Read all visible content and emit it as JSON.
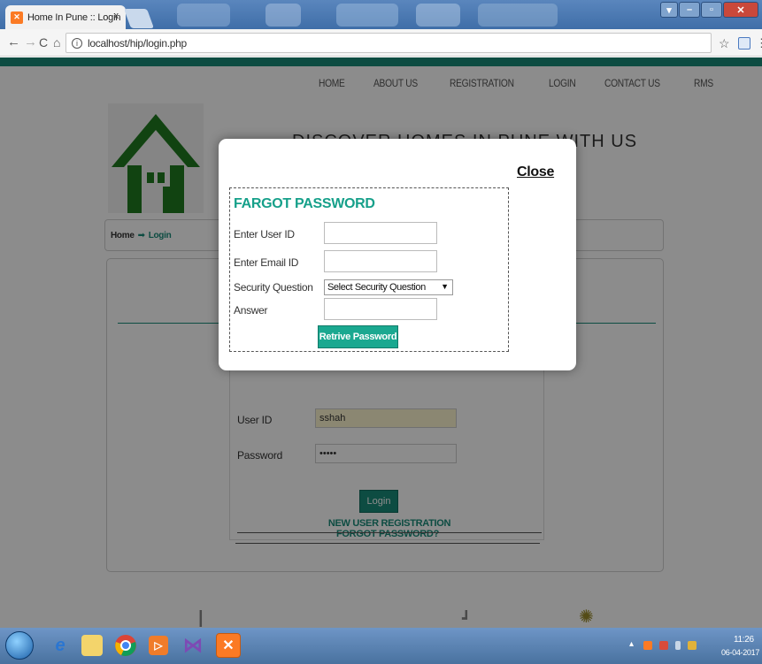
{
  "browser": {
    "tab_title": "Home In Pune :: Login",
    "tab_close": "x",
    "favicon": "xampp-icon",
    "url": "localhost/hip/login.php",
    "back_icon": "back-arrow-icon",
    "forward_icon": "forward-arrow-icon",
    "reload_icon": "reload-icon",
    "home_icon": "home-icon",
    "bookmark_icon": "star-icon"
  },
  "page": {
    "nav": [
      "HOME",
      "ABOUT US",
      "REGISTRATION",
      "LOGIN",
      "CONTACT US",
      "RMS"
    ],
    "tagline": "DISCOVER HOMES IN PUNE WITH US",
    "breadcrumb": {
      "home": "Home",
      "current": "Login"
    },
    "login": {
      "userid_label": "User ID",
      "userid_value": "sshah",
      "password_label": "Password",
      "password_value": "•••••",
      "login_button": "Login",
      "forgot_link": "FORGOT PASSWORD?",
      "register_link": "NEW USER REGISTRATION"
    }
  },
  "modal": {
    "close_label": "Close",
    "title": "FARGOT PASSWORD",
    "fields": {
      "userid_label": "Enter User ID",
      "email_label": "Enter Email ID",
      "question_label": "Security Question",
      "question_selected": "Select Security Question",
      "answer_label": "Answer"
    },
    "submit_label": "Retrive Password"
  },
  "taskbar": {
    "time": "11:26",
    "date": "06-04-2017"
  },
  "colors": {
    "accent": "#188b79",
    "modal_title": "#16a08a",
    "button": "#1aa890"
  }
}
